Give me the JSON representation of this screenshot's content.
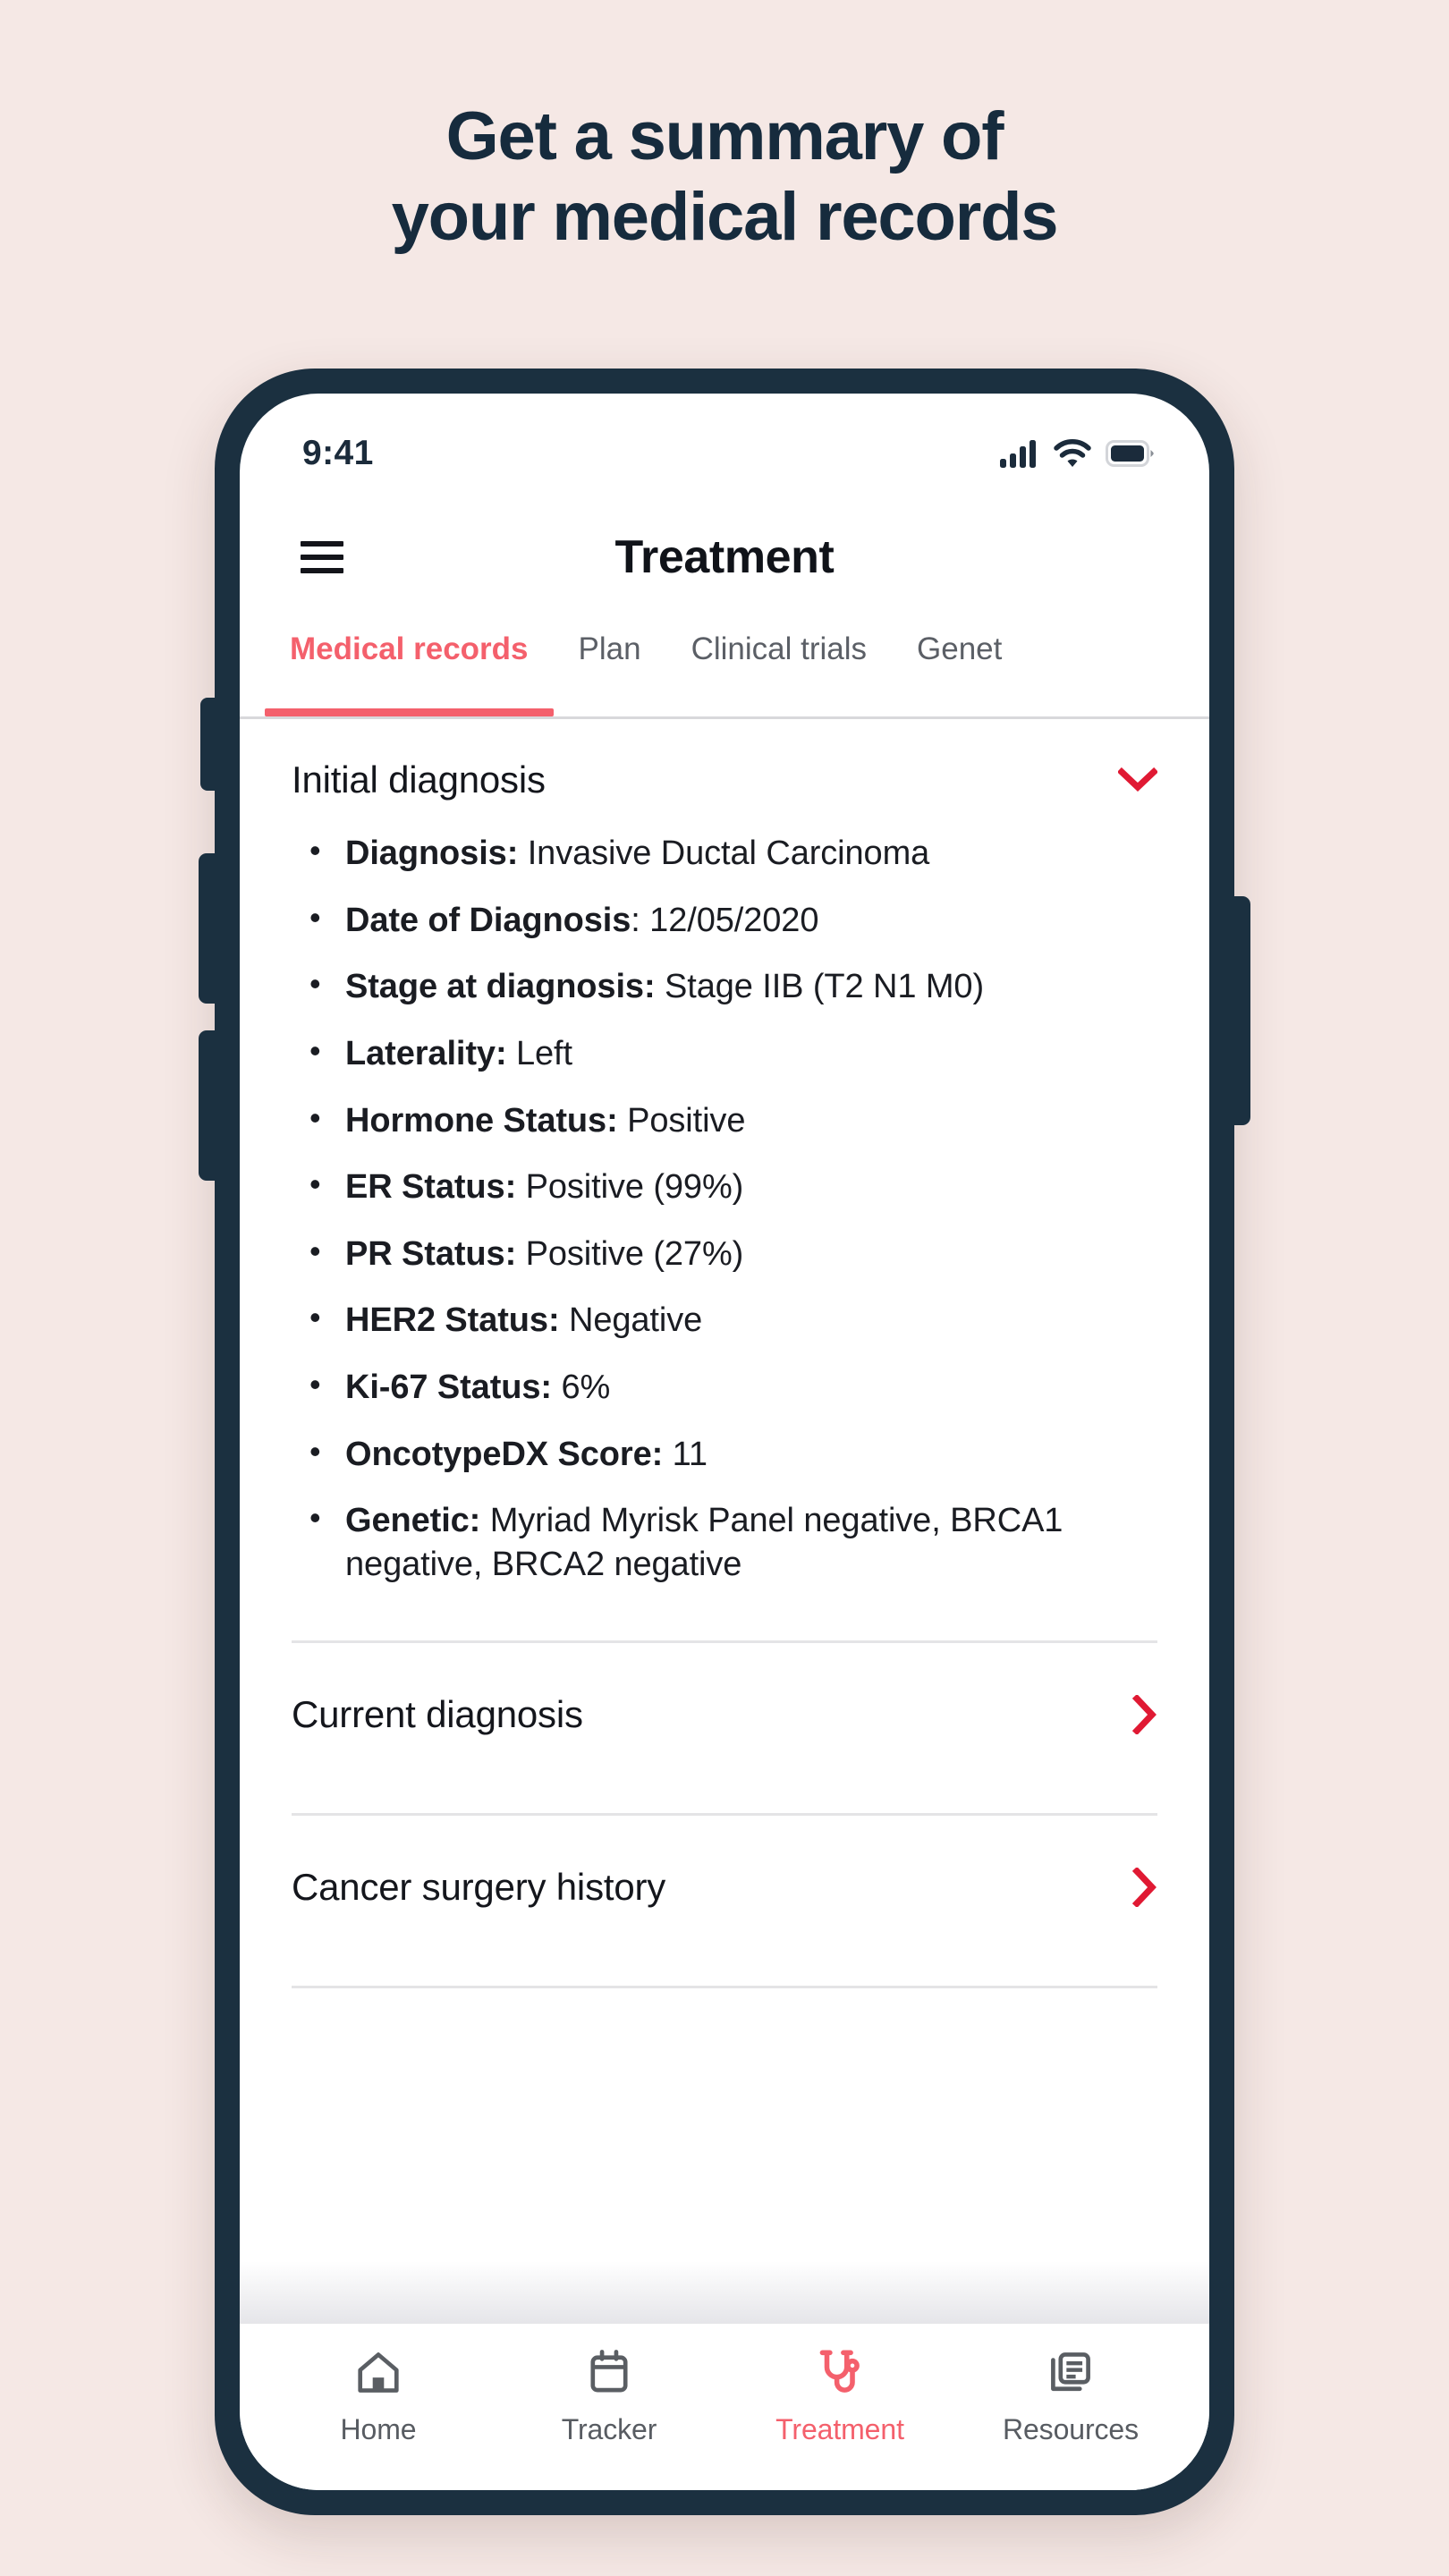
{
  "headline": {
    "line1": "Get a summary of",
    "line2": "your medical records"
  },
  "colors": {
    "page_background": "#F5E8E5",
    "phone_frame": "#1B3040",
    "accent_coral": "#F4606C",
    "chevron_red": "#E01933",
    "text_dark": "#14161C",
    "text_muted": "#5B5F66"
  },
  "status_bar": {
    "time": "9:41",
    "icons": [
      "signal-icon",
      "wifi-icon",
      "battery-icon"
    ]
  },
  "app_bar": {
    "menu_icon": "hamburger-menu-icon",
    "title": "Treatment"
  },
  "tabs": [
    {
      "label": "Medical records",
      "active": true
    },
    {
      "label": "Plan",
      "active": false
    },
    {
      "label": "Clinical trials",
      "active": false
    },
    {
      "label": "Genet",
      "active": false
    }
  ],
  "main": {
    "expanded_section": {
      "title": "Initial diagnosis",
      "toggle_icon": "chevron-down-icon",
      "expanded": true,
      "items": [
        {
          "label": "Diagnosis:",
          "value": "Invasive Ductal Carcinoma"
        },
        {
          "label": "Date of Diagnosis",
          "value": ": 12/05/2020"
        },
        {
          "label": "Stage at diagnosis:",
          "value": "Stage IIB (T2 N1 M0)"
        },
        {
          "label": "Laterality:",
          "value": "Left"
        },
        {
          "label": "Hormone Status:",
          "value": "Positive"
        },
        {
          "label": "ER Status:",
          "value": "Positive (99%)"
        },
        {
          "label": "PR Status:",
          "value": "Positive (27%)"
        },
        {
          "label": "HER2 Status:",
          "value": "Negative"
        },
        {
          "label": "Ki-67 Status:",
          "value": "6%"
        },
        {
          "label": "OncotypeDX Score:",
          "value": "11"
        },
        {
          "label": "Genetic:",
          "value": "Myriad Myrisk Panel negative, BRCA1 negative, BRCA2 negative"
        }
      ]
    },
    "collapsed_sections": [
      {
        "title": "Current diagnosis",
        "toggle_icon": "chevron-right-icon"
      },
      {
        "title": "Cancer surgery history",
        "toggle_icon": "chevron-right-icon"
      }
    ]
  },
  "bottom_nav": [
    {
      "label": "Home",
      "icon": "home-icon",
      "active": false
    },
    {
      "label": "Tracker",
      "icon": "calendar-icon",
      "active": false
    },
    {
      "label": "Treatment",
      "icon": "stethoscope-icon",
      "active": true
    },
    {
      "label": "Resources",
      "icon": "article-icon",
      "active": false
    }
  ]
}
